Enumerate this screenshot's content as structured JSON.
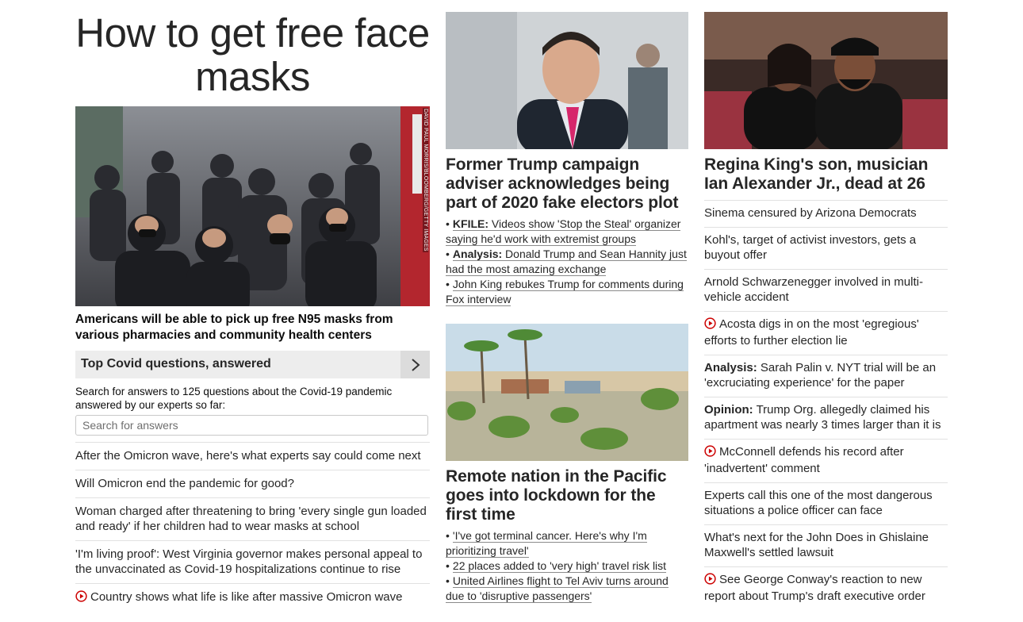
{
  "col1": {
    "big_title": "How to get free face masks",
    "hero_credit": "DAVID PAUL MORRIS/BLOOMBERG/GETTY IMAGES",
    "hero_caption": "Americans will be able to pick up free N95 masks from various pharmacies and community health centers",
    "covid": {
      "title": "Top Covid questions, answered",
      "description": "Search for answers to 125 questions about the Covid-19 pandemic answered by our experts so far:",
      "placeholder": "Search for answers"
    },
    "list": [
      {
        "text": "After the Omicron wave, here's what experts say could come next",
        "video": false
      },
      {
        "text": "Will Omicron end the pandemic for good?",
        "video": false
      },
      {
        "text": "Woman charged after threatening to bring 'every single gun loaded and ready' if her children had to wear masks at school",
        "video": false
      },
      {
        "text": "'I'm living proof': West Virginia governor makes personal appeal to the unvaccinated as Covid-19 hospitalizations continue to rise",
        "video": false
      },
      {
        "text": "Country shows what life is like after massive Omicron wave",
        "video": true
      }
    ]
  },
  "col2": {
    "story1": {
      "headline": "Former Trump campaign adviser acknowledges being part of 2020 fake electors plot",
      "bullets": [
        {
          "label": "KFILE:",
          "text": "Videos show 'Stop the Steal' organizer saying he'd work with extremist groups"
        },
        {
          "label": "Analysis:",
          "text": "Donald Trump and Sean Hannity just had the most amazing exchange"
        },
        {
          "label": "",
          "text": "John King rebukes Trump for comments during Fox interview"
        }
      ]
    },
    "story2": {
      "headline": "Remote nation in the Pacific goes into lockdown for the first time",
      "bullets": [
        {
          "label": "",
          "text": "'I've got terminal cancer. Here's why I'm prioritizing travel'"
        },
        {
          "label": "",
          "text": "22 places added to 'very high' travel risk list"
        },
        {
          "label": "",
          "text": "United Airlines flight to Tel Aviv turns around due to 'disruptive passengers'"
        }
      ]
    }
  },
  "col3": {
    "headline": "Regina King's son, musician Ian Alexander Jr., dead at 26",
    "list": [
      {
        "label": "",
        "text": "Sinema censured by Arizona Democrats",
        "video": false
      },
      {
        "label": "",
        "text": "Kohl's, target of activist investors, gets a buyout offer",
        "video": false
      },
      {
        "label": "",
        "text": "Arnold Schwarzenegger involved in multi-vehicle accident",
        "video": false
      },
      {
        "label": "",
        "text": "Acosta digs in on the most 'egregious' efforts to further election lie",
        "video": true
      },
      {
        "label": "Analysis:",
        "text": "Sarah Palin v. NYT trial will be an 'excruciating experience' for the paper",
        "video": false
      },
      {
        "label": "Opinion:",
        "text": "Trump Org. allegedly claimed his apartment was nearly 3 times larger than it is",
        "video": false
      },
      {
        "label": "",
        "text": "McConnell defends his record after 'inadvertent' comment",
        "video": true
      },
      {
        "label": "",
        "text": "Experts call this one of the most dangerous situations a police officer can face",
        "video": false
      },
      {
        "label": "",
        "text": "What's next for the John Does in Ghislaine Maxwell's settled lawsuit",
        "video": false
      },
      {
        "label": "",
        "text": "See George Conway's reaction to new report about Trump's draft executive order",
        "video": true
      }
    ]
  },
  "colors": {
    "video_red": "#cc0000",
    "text": "#262626",
    "divider": "#e1e1e1"
  }
}
